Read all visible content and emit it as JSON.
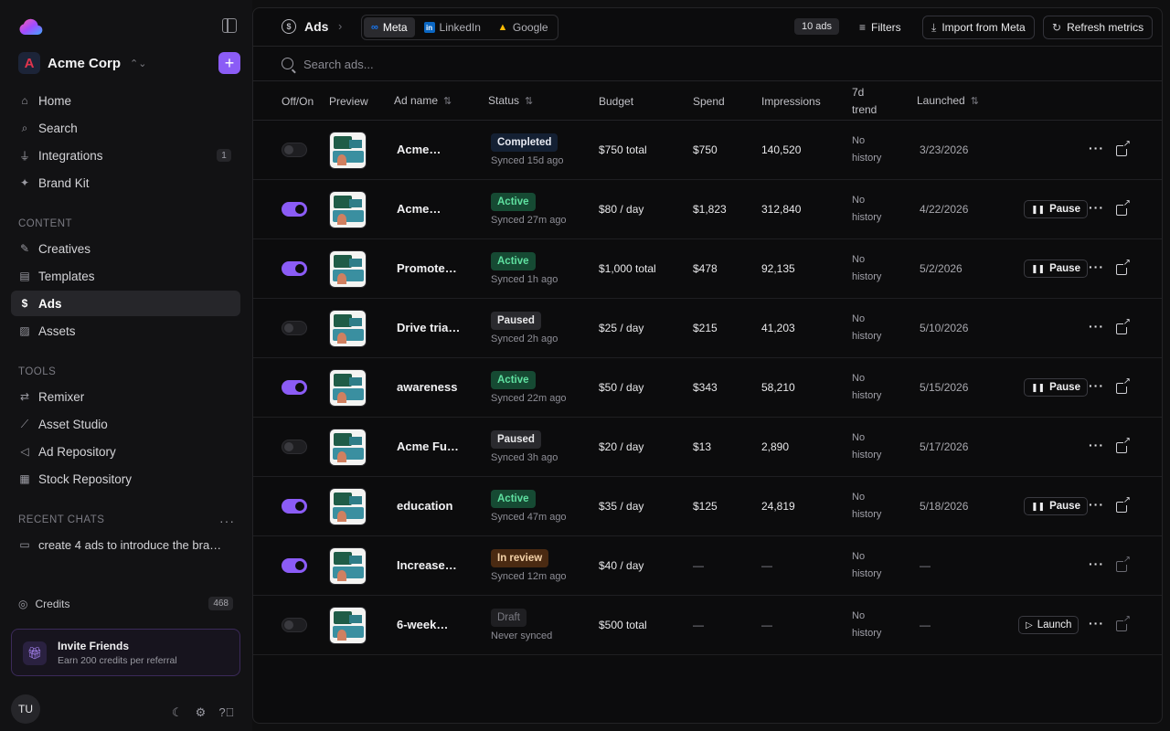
{
  "sidebar": {
    "org_name": "Acme Corp",
    "org_initial": "A",
    "nav": [
      {
        "label": "Home",
        "icon": "home-icon",
        "glyph": "⌂"
      },
      {
        "label": "Search",
        "icon": "search-icon",
        "glyph": "⌕"
      },
      {
        "label": "Integrations",
        "icon": "plug-icon",
        "glyph": "⏚",
        "badge": "1"
      },
      {
        "label": "Brand Kit",
        "icon": "sparkle-icon",
        "glyph": "✦"
      }
    ],
    "content_label": "CONTENT",
    "content": [
      {
        "label": "Creatives",
        "icon": "brush-icon",
        "glyph": "✎"
      },
      {
        "label": "Templates",
        "icon": "template-icon",
        "glyph": "▤"
      },
      {
        "label": "Ads",
        "icon": "dollar-icon",
        "glyph": "$",
        "active": true
      },
      {
        "label": "Assets",
        "icon": "image-icon",
        "glyph": "▨"
      }
    ],
    "tools_label": "TOOLS",
    "tools": [
      {
        "label": "Remixer",
        "icon": "shuffle-icon",
        "glyph": "⇄"
      },
      {
        "label": "Asset Studio",
        "icon": "wand-icon",
        "glyph": "⟋"
      },
      {
        "label": "Ad Repository",
        "icon": "megaphone-icon",
        "glyph": "◁"
      },
      {
        "label": "Stock Repository",
        "icon": "grid-icon",
        "glyph": "▦"
      }
    ],
    "recent_label": "RECENT CHATS",
    "recent": [
      {
        "label": "create 4 ads to introduce the bra…",
        "icon": "chat-icon",
        "glyph": "▭"
      }
    ],
    "credits_label": "Credits",
    "credits_value": "468",
    "invite_title": "Invite Friends",
    "invite_sub": "Earn 200 credits per referral",
    "user_initials": "TU"
  },
  "topbar": {
    "title": "Ads",
    "platforms": [
      {
        "label": "Meta",
        "active": true
      },
      {
        "label": "LinkedIn",
        "active": false
      },
      {
        "label": "Google",
        "active": false
      }
    ],
    "ads_count": "10 ads",
    "filters": "Filters",
    "import": "Import from Meta",
    "refresh": "Refresh metrics"
  },
  "search": {
    "placeholder": "Search ads..."
  },
  "columns": {
    "offon": "Off/On",
    "preview": "Preview",
    "name": "Ad name",
    "status": "Status",
    "budget": "Budget",
    "spend": "Spend",
    "impressions": "Impressions",
    "trend_l1": "7d",
    "trend_l2": "trend",
    "launched": "Launched"
  },
  "colors": {
    "accent": "#8b5cf6",
    "active_green": "#5fe0a0"
  },
  "rows": [
    {
      "on": false,
      "name": "Acme…",
      "status": "Completed",
      "status_class": "st-completed",
      "synced": "Synced 15d ago",
      "budget": "$750 total",
      "spend": "$750",
      "impressions": "140,520",
      "trend1": "No",
      "trend2": "history",
      "launched": "3/23/2026",
      "action": ""
    },
    {
      "on": true,
      "name": "Acme…",
      "status": "Active",
      "status_class": "st-active",
      "synced": "Synced 27m ago",
      "budget": "$80 / day",
      "spend": "$1,823",
      "impressions": "312,840",
      "trend1": "No",
      "trend2": "history",
      "launched": "4/22/2026",
      "action": "Pause"
    },
    {
      "on": true,
      "name": "Promote…",
      "status": "Active",
      "status_class": "st-active",
      "synced": "Synced 1h ago",
      "budget": "$1,000 total",
      "spend": "$478",
      "impressions": "92,135",
      "trend1": "No",
      "trend2": "history",
      "launched": "5/2/2026",
      "action": "Pause"
    },
    {
      "on": false,
      "name": "Drive tria…",
      "status": "Paused",
      "status_class": "st-paused",
      "synced": "Synced 2h ago",
      "budget": "$25 / day",
      "spend": "$215",
      "impressions": "41,203",
      "trend1": "No",
      "trend2": "history",
      "launched": "5/10/2026",
      "action": ""
    },
    {
      "on": true,
      "name": "awareness",
      "status": "Active",
      "status_class": "st-active",
      "synced": "Synced 22m ago",
      "budget": "$50 / day",
      "spend": "$343",
      "impressions": "58,210",
      "trend1": "No",
      "trend2": "history",
      "launched": "5/15/2026",
      "action": "Pause"
    },
    {
      "on": false,
      "name": "Acme Fu…",
      "status": "Paused",
      "status_class": "st-paused",
      "synced": "Synced 3h ago",
      "budget": "$20 / day",
      "spend": "$13",
      "impressions": "2,890",
      "trend1": "No",
      "trend2": "history",
      "launched": "5/17/2026",
      "action": ""
    },
    {
      "on": true,
      "name": "education",
      "status": "Active",
      "status_class": "st-active",
      "synced": "Synced 47m ago",
      "budget": "$35 / day",
      "spend": "$125",
      "impressions": "24,819",
      "trend1": "No",
      "trend2": "history",
      "launched": "5/18/2026",
      "action": "Pause"
    },
    {
      "on": true,
      "name": "Increase…",
      "status": "In review",
      "status_class": "st-review",
      "synced": "Synced 12m ago",
      "budget": "$40 / day",
      "spend": "—",
      "impressions": "—",
      "trend1": "No",
      "trend2": "history",
      "launched": "—",
      "action": ""
    },
    {
      "on": false,
      "name": "6-week…",
      "status": "Draft",
      "status_class": "st-draft",
      "synced": "Never synced",
      "budget": "$500 total",
      "spend": "—",
      "impressions": "—",
      "trend1": "No",
      "trend2": "history",
      "launched": "—",
      "action": "Launch"
    }
  ]
}
